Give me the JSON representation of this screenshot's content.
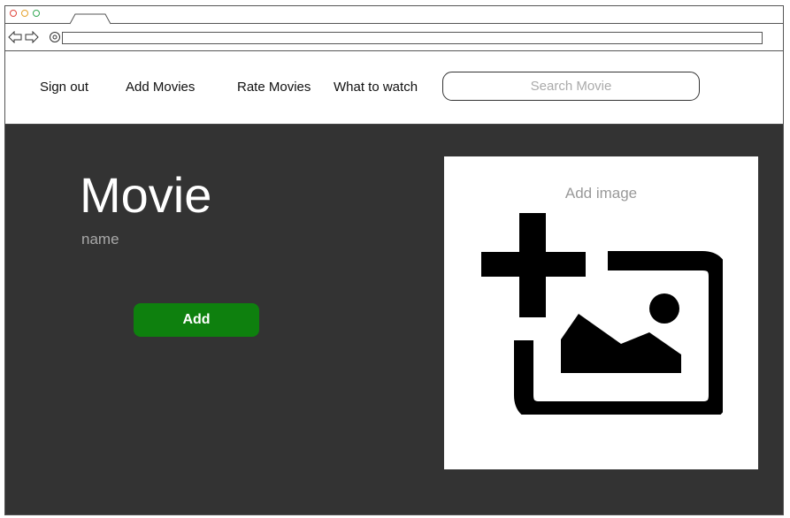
{
  "nav": {
    "items": [
      {
        "label": "Sign out"
      },
      {
        "label": "Add Movies"
      },
      {
        "label": "Rate Movies"
      },
      {
        "label": "What to watch"
      }
    ],
    "search_placeholder": "Search Movie"
  },
  "main": {
    "title": "Movie",
    "subtitle": "name",
    "add_button_label": "Add",
    "image_placeholder_label": "Add image"
  },
  "colors": {
    "page_background": "#333333",
    "add_button": "#0e800e",
    "dot_red": "#e0453c",
    "dot_amber": "#e5a028",
    "dot_green": "#33a853"
  },
  "icons": {
    "address_bar": [
      "back-arrow-icon",
      "forward-arrow-icon",
      "site-info-icon"
    ],
    "image_panel": "add-photo-icon"
  }
}
